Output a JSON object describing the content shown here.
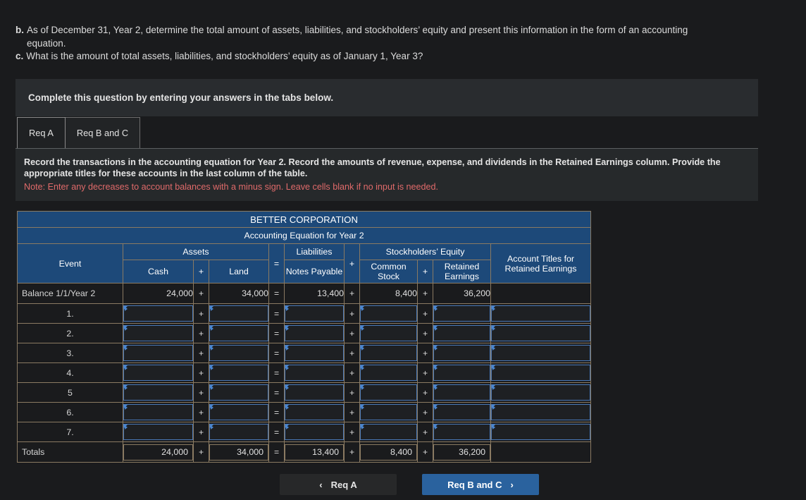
{
  "prompt": {
    "lines": [
      {
        "letter": "b.",
        "text": "As of December 31, Year 2, determine the total amount of assets, liabilities, and stockholders’ equity and present this information in the form of an accounting equation."
      },
      {
        "letter": "c.",
        "text": "What is the amount of total assets, liabilities, and stockholders’ equity as of January 1, Year 3?"
      }
    ]
  },
  "banner": {
    "text": "Complete this question by entering your answers in the tabs below."
  },
  "tabs": [
    {
      "label": "Req A",
      "active": true
    },
    {
      "label": "Req B and C",
      "active": false
    }
  ],
  "instructions": {
    "main": "Record the transactions in the accounting equation for Year 2. Record the amounts of revenue, expense, and dividends in the Retained Earnings column. Provide the appropriate titles for these accounts in the last column of the table.",
    "note": "Note: Enter any decreases to account balances with a minus sign. Leave cells blank if no input is needed."
  },
  "table": {
    "company": "BETTER CORPORATION",
    "subtitle": "Accounting Equation for Year 2",
    "groups": {
      "event": "Event",
      "assets": "Assets",
      "liabilities": "Liabilities",
      "stockholders_equity": "Stockholders’ Equity",
      "account_titles": "Account Titles for Retained Earnings"
    },
    "columns": {
      "cash": "Cash",
      "land": "Land",
      "notes_payable": "Notes Payable",
      "common_stock": "Common Stock",
      "retained_earnings": "Retained Earnings"
    },
    "operators": {
      "plus": "+",
      "equals": "="
    },
    "balance_row": {
      "label": "Balance 1/1/Year 2",
      "cash": "24,000",
      "land": "34,000",
      "notes_payable": "13,400",
      "common_stock": "8,400",
      "retained_earnings": "36,200",
      "account_title": ""
    },
    "event_rows": [
      {
        "label": "1."
      },
      {
        "label": "2."
      },
      {
        "label": "3."
      },
      {
        "label": "4."
      },
      {
        "label": "5"
      },
      {
        "label": "6."
      },
      {
        "label": "7."
      }
    ],
    "totals_row": {
      "label": "Totals",
      "cash": "24,000",
      "land": "34,000",
      "notes_payable": "13,400",
      "common_stock": "8,400",
      "retained_earnings": "36,200",
      "account_title": ""
    }
  },
  "nav": {
    "prev_label": "Req A",
    "next_label": "Req B and C",
    "prev_chevron": "‹",
    "next_chevron": "›"
  },
  "colors": {
    "header_blue": "#1d4979",
    "table_border": "#8a7a62",
    "input_border": "#4a79b8",
    "note_red": "#e06a6a",
    "primary_button": "#2a629e",
    "page_bg": "#1a1b1d"
  }
}
